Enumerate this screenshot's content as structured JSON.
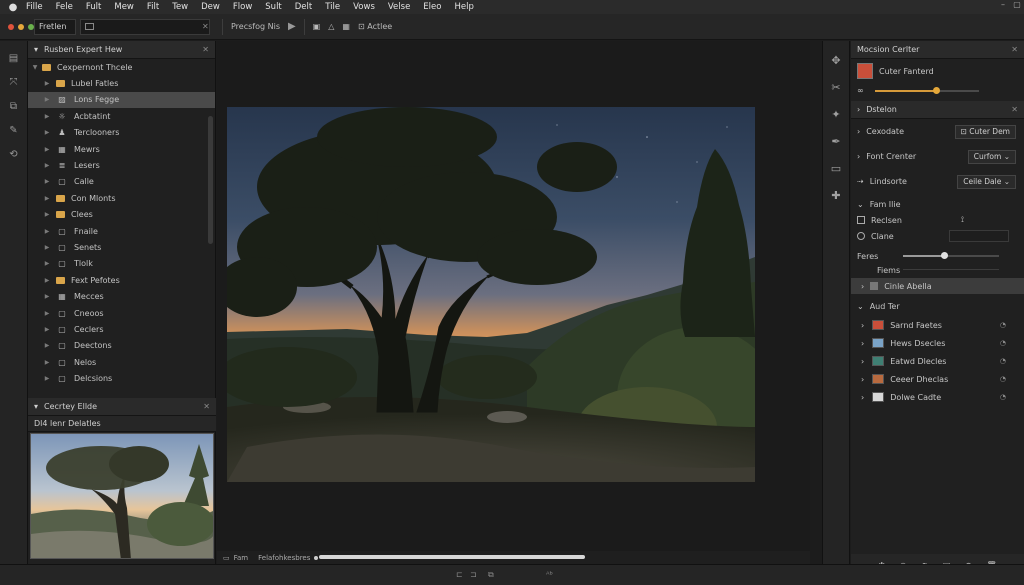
{
  "menubar": {
    "apple": "",
    "items": [
      "Fille",
      "Fele",
      "Fult",
      "Mew",
      "Filt",
      "Tew",
      "Dew",
      "Flow",
      "Sult",
      "Delt",
      "Tile",
      "Vows",
      "Velse",
      "Eleo",
      "Help"
    ]
  },
  "toolbar": {
    "workspace_label": "Fretlen",
    "tool_label": "Precsfog Nis",
    "action_label": "Actlee",
    "dot_colors": [
      "#e0533c",
      "#e6a83b",
      "#6ab04c"
    ]
  },
  "left_panel": {
    "title": "Rusben Expert Hew",
    "root": "Cexpernont Thcele",
    "items": [
      {
        "label": "Lubel Fatles",
        "icon": "folder-icon"
      },
      {
        "label": "Lons Fegge",
        "icon": "image-icon"
      },
      {
        "label": "Acbtatint",
        "icon": "adjust-icon"
      },
      {
        "label": "Terclooners",
        "icon": "person-icon"
      },
      {
        "label": "Mewrs",
        "icon": "grid-icon"
      },
      {
        "label": "Lesers",
        "icon": "layer-icon"
      },
      {
        "label": "Calle",
        "icon": "square-icon"
      },
      {
        "label": "Con Mlonts",
        "icon": "folder-icon"
      },
      {
        "label": "Clees",
        "icon": "folder-icon"
      },
      {
        "label": "Fnaile",
        "icon": "square-icon"
      },
      {
        "label": "Senets",
        "icon": "square-icon"
      },
      {
        "label": "Tlolk",
        "icon": "square-icon"
      },
      {
        "label": "Fext Pefotes",
        "icon": "folder-icon"
      },
      {
        "label": "Mecces",
        "icon": "grid-icon"
      },
      {
        "label": "Cneoos",
        "icon": "square-icon"
      },
      {
        "label": "Ceclers",
        "icon": "square-icon"
      },
      {
        "label": "Deectons",
        "icon": "square-icon"
      },
      {
        "label": "Nelos",
        "icon": "square-icon"
      },
      {
        "label": "Delcsions",
        "icon": "square-icon"
      }
    ],
    "section2_title": "Cecrtey Ellde",
    "section3_title": "Dl4 lenr Delatles"
  },
  "canvas_footer": {
    "zoom_label": "Fam",
    "file_label": "Felafohkesbres"
  },
  "right_panel": {
    "header1": "Mocsion Cerlter",
    "layer_name": "Cuter Fanterd",
    "header2": "Dstelon",
    "rows": [
      {
        "label": "Cexodate",
        "button": "Cuter Dem"
      },
      {
        "label": "Font Crenter",
        "button": "Curfom"
      },
      {
        "label": "Lindsorte",
        "button": "Ceile Dale"
      }
    ],
    "section_title": "Fam Ilie",
    "check_label": "Reclsen",
    "radio_label": "Clane",
    "slider_label": "Feres",
    "sublabel": "Fiems",
    "highlight_row": "Cinle Abella",
    "group_title": "Aud Ter",
    "thumbs": [
      {
        "label": "Sarnd Faetes",
        "color": "#c94f3a"
      },
      {
        "label": "Hews Dsecles",
        "color": "#7aa3c7"
      },
      {
        "label": "Eatwd Dlecles",
        "color": "#3f7f73"
      },
      {
        "label": "Ceeer Dheclas",
        "color": "#b86a3f"
      },
      {
        "label": "Dolwe Cadte",
        "color": "#d8d8d8"
      }
    ],
    "slider1_value": 0.7,
    "slider2_value": 0.4,
    "accent": "#e5a83a"
  }
}
